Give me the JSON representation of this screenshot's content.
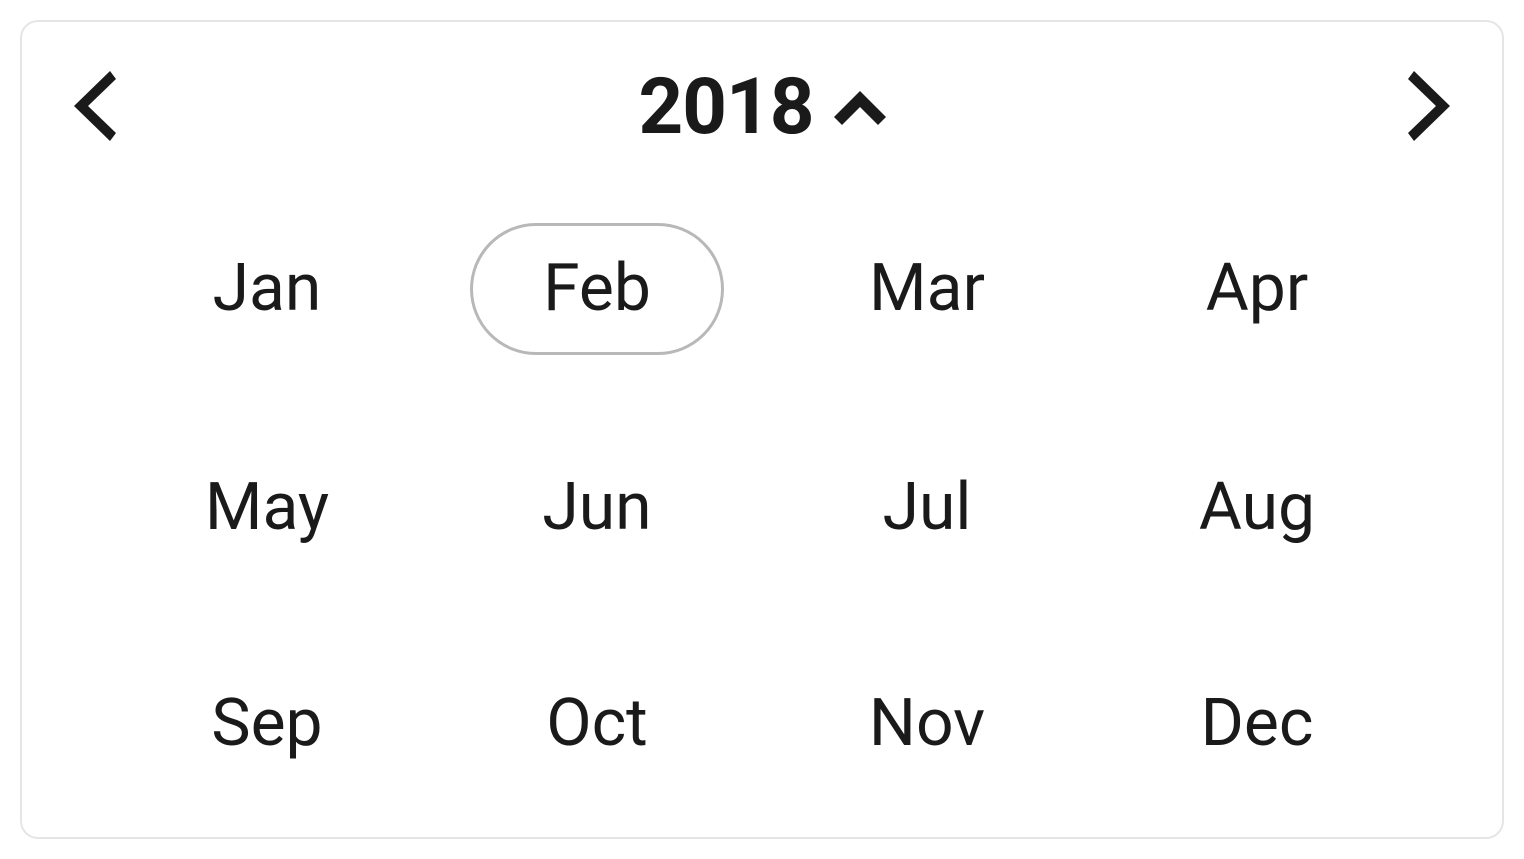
{
  "year": "2018",
  "months": [
    {
      "label": "Jan",
      "selected": false
    },
    {
      "label": "Feb",
      "selected": true
    },
    {
      "label": "Mar",
      "selected": false
    },
    {
      "label": "Apr",
      "selected": false
    },
    {
      "label": "May",
      "selected": false
    },
    {
      "label": "Jun",
      "selected": false
    },
    {
      "label": "Jul",
      "selected": false
    },
    {
      "label": "Aug",
      "selected": false
    },
    {
      "label": "Sep",
      "selected": false
    },
    {
      "label": "Oct",
      "selected": false
    },
    {
      "label": "Nov",
      "selected": false
    },
    {
      "label": "Dec",
      "selected": false
    }
  ]
}
